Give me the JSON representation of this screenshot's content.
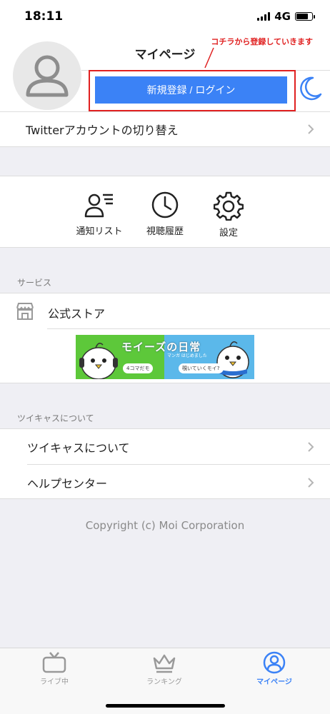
{
  "status_bar": {
    "time": "18:11",
    "network": "4G",
    "battery_level": 0.75
  },
  "header": {
    "title": "マイページ",
    "login_button_label": "新規登録 / ログイン",
    "annotation_text": "コチラから登録していきます",
    "annotation_color": "#e02020"
  },
  "twitter_switch": {
    "label": "Twitterアカウントの切り替え"
  },
  "shortcuts": {
    "notifications_label": "通知リスト",
    "history_label": "視聴履歴",
    "settings_label": "設定"
  },
  "services": {
    "section_title": "サービス",
    "store_label": "公式ストア",
    "banner": {
      "title": "モイーズの日常",
      "subtitle": "マンガ はじめました",
      "tag_left": "4コマだモ",
      "tag_right": "覗いていくモイ?"
    }
  },
  "about": {
    "section_title": "ツイキャスについて",
    "items": [
      {
        "label": "ツイキャスについて"
      },
      {
        "label": "ヘルプセンター"
      }
    ]
  },
  "footer": {
    "copyright": "Copyright (c) Moi Corporation"
  },
  "tab_bar": {
    "accent_color": "#3b82f6",
    "tabs": [
      {
        "label": "ライブ中"
      },
      {
        "label": "ランキング"
      },
      {
        "label": "マイページ"
      }
    ]
  }
}
